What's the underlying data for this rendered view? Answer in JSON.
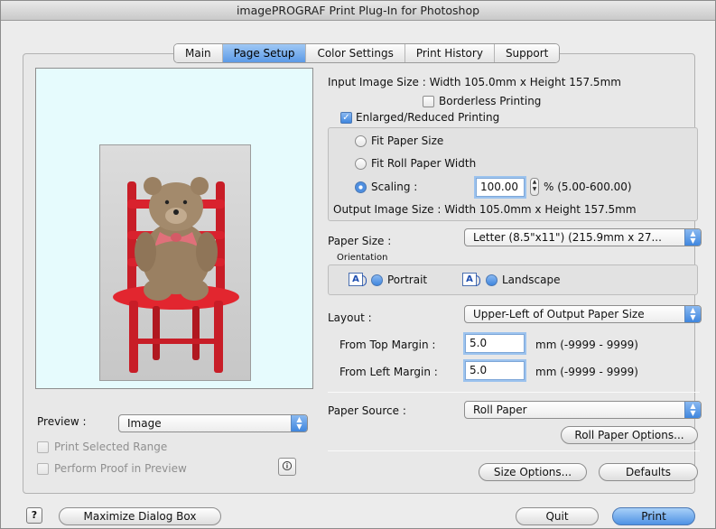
{
  "window": {
    "title": "imagePROGRAF Print Plug-In for Photoshop"
  },
  "tabs": [
    {
      "label": "Main",
      "active": false
    },
    {
      "label": "Page Setup",
      "active": true
    },
    {
      "label": "Color Settings",
      "active": false
    },
    {
      "label": "Print History",
      "active": false
    },
    {
      "label": "Support",
      "active": false
    }
  ],
  "input_image_size": "Input Image Size : Width 105.0mm x Height 157.5mm",
  "borderless": {
    "label": "Borderless Printing",
    "checked": false
  },
  "enlarged": {
    "label": "Enlarged/Reduced Printing",
    "checked": true
  },
  "fit_paper": {
    "label": "Fit Paper Size"
  },
  "fit_roll": {
    "label": "Fit Roll Paper Width"
  },
  "scaling": {
    "label": "Scaling :",
    "value": "100.00",
    "range": "% (5.00-600.00)"
  },
  "output_image_size": "Output Image Size : Width 105.0mm x Height 157.5mm",
  "paper_size": {
    "label": "Paper Size :",
    "value": "Letter (8.5\"x11\") (215.9mm x 27..."
  },
  "orientation": {
    "label": "Orientation",
    "portrait": "Portrait",
    "landscape": "Landscape"
  },
  "layout": {
    "label": "Layout :",
    "value": "Upper-Left of Output Paper Size"
  },
  "top_margin": {
    "label": "From Top Margin :",
    "value": "5.0",
    "range": "mm  (-9999 - 9999)"
  },
  "left_margin": {
    "label": "From Left Margin :",
    "value": "5.0",
    "range": "mm  (-9999 - 9999)"
  },
  "paper_source": {
    "label": "Paper Source :",
    "value": "Roll Paper"
  },
  "buttons": {
    "roll_options": "Roll Paper Options...",
    "size_options": "Size Options...",
    "defaults": "Defaults",
    "maximize": "Maximize Dialog Box",
    "quit": "Quit",
    "print": "Print",
    "help": "?"
  },
  "preview": {
    "label": "Preview :",
    "value": "Image",
    "print_selected_range": "Print Selected Range",
    "perform_proof": "Perform Proof in Preview"
  },
  "colors": {
    "accent": "#4e92e4",
    "preview_bg": "#e6fbfd",
    "chair": "#d9222e"
  }
}
